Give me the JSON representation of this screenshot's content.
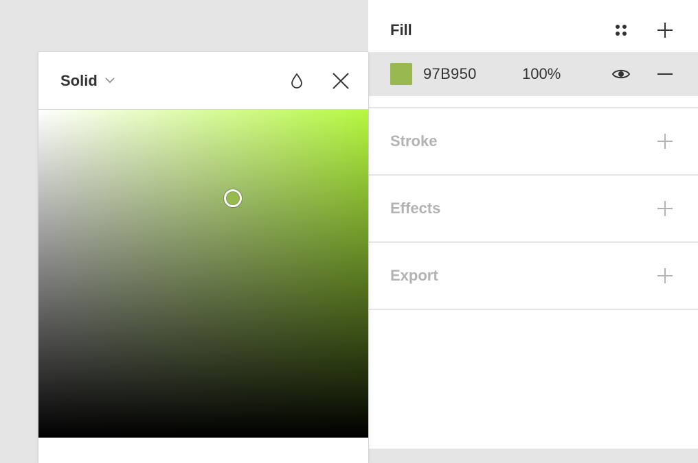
{
  "picker": {
    "fill_type": "Solid",
    "hue_color": "#b5f83f",
    "icons": {
      "dropdown": "chevron-down-icon",
      "eyedropper": "drop-icon",
      "close": "close-icon"
    },
    "saturation": 0.59,
    "brightness": 0.73
  },
  "panel": {
    "fill": {
      "title": "Fill",
      "swatch_color": "#97B950",
      "hex": "97B950",
      "opacity": "100%",
      "icons": {
        "styles": "styles-grid-icon",
        "add": "plus-icon",
        "visibility": "eye-icon",
        "remove": "minus-icon"
      }
    },
    "sections": [
      {
        "title": "Stroke"
      },
      {
        "title": "Effects"
      },
      {
        "title": "Export"
      }
    ]
  }
}
